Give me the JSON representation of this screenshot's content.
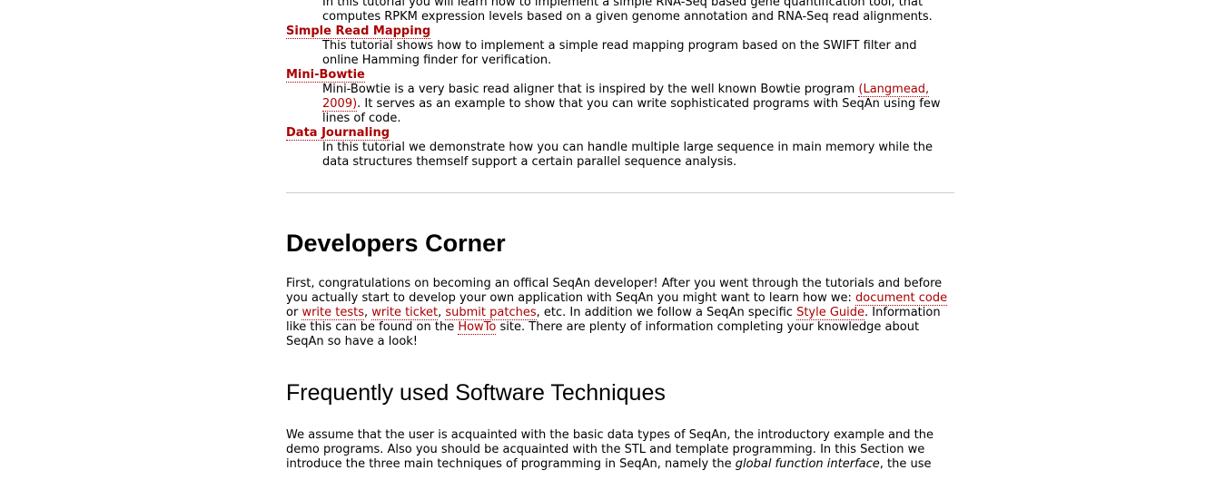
{
  "tutorials": [
    {
      "title": "",
      "desc": "In this tutorial you will learn how to implement a simple RNA-Seq based gene quantification tool, that computes RPKM expression levels based on a given genome annotation and RNA-Seq read alignments."
    },
    {
      "title": "Simple Read Mapping",
      "desc": "This tutorial shows how to implement a simple read mapping program based on the SWIFT filter and online Hamming finder for verification."
    },
    {
      "title": "Mini-Bowtie",
      "desc_before": "Mini-Bowtie is a very basic read aligner that is inspired by the well known Bowtie program ",
      "desc_link": "(Langmead, 2009)",
      "desc_after": ". It serves as an example to show that you can write sophisticated programs with SeqAn using few lines of code."
    },
    {
      "title": "Data Journaling",
      "desc": "In this tutorial we demonstrate how you can handle multiple large sequence in main memory while the data structures themself support a certain parallel sequence analysis."
    }
  ],
  "developers": {
    "heading": "Developers Corner",
    "p1": "First, congratulations on becoming an offical SeqAn developer! After you went through the tutorials and before you actually start to develop your own application with SeqAn you might want to learn how we: ",
    "link_document_code": "document code",
    "t_or": " or ",
    "link_write_tests": "write tests",
    "t_comma1": ", ",
    "link_write_ticket": "write ticket",
    "t_comma2": ", ",
    "link_submit_patches": "submit patches",
    "t_after_patches": ", etc. In addition we follow a SeqAn specific ",
    "link_style_guide": "Style Guide",
    "t_after_style": ". Information like this can be found on the ",
    "link_howto": "HowTo",
    "t_end": " site. There are plenty of information completing your knowledge about SeqAn so have a look!"
  },
  "techniques": {
    "heading": "Frequently used Software Techniques",
    "p_before": "We assume that the user is acquainted with the basic data types of SeqAn, the introductory example and the demo programs. Also you should be acquainted with the STL and template programming. In this Section we introduce the three main techniques of programming in SeqAn, namely the ",
    "p_italic": "global function interface",
    "p_after": ", the use"
  }
}
